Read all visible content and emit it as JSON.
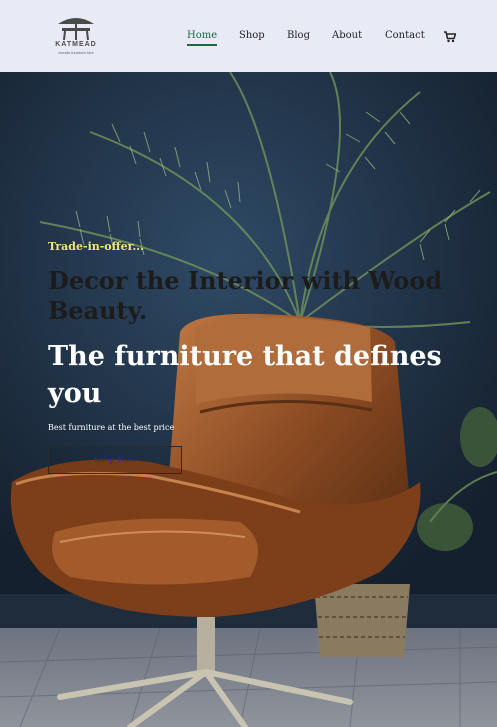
{
  "logo": {
    "name": "KATMEAD",
    "tagline": "events furniture hire"
  },
  "nav": {
    "items": [
      {
        "label": "Home",
        "active": true
      },
      {
        "label": "Shop",
        "active": false
      },
      {
        "label": "Blog",
        "active": false
      },
      {
        "label": "About",
        "active": false
      },
      {
        "label": "Contact",
        "active": false
      }
    ],
    "cart_icon": "cart-icon"
  },
  "hero": {
    "offer": "Trade-in-offer...",
    "headline_dark": "Decor the Interior with Wood Beauty.",
    "headline_light": "The furniture that defines you",
    "subtext": "Best furniture at the best price",
    "button_label": "Shop Now"
  },
  "colors": {
    "nav_bg": "#e8eaf5",
    "active_nav": "#1a6a3d",
    "offer_text": "#f2e57a",
    "button_text": "#2d2a80"
  }
}
